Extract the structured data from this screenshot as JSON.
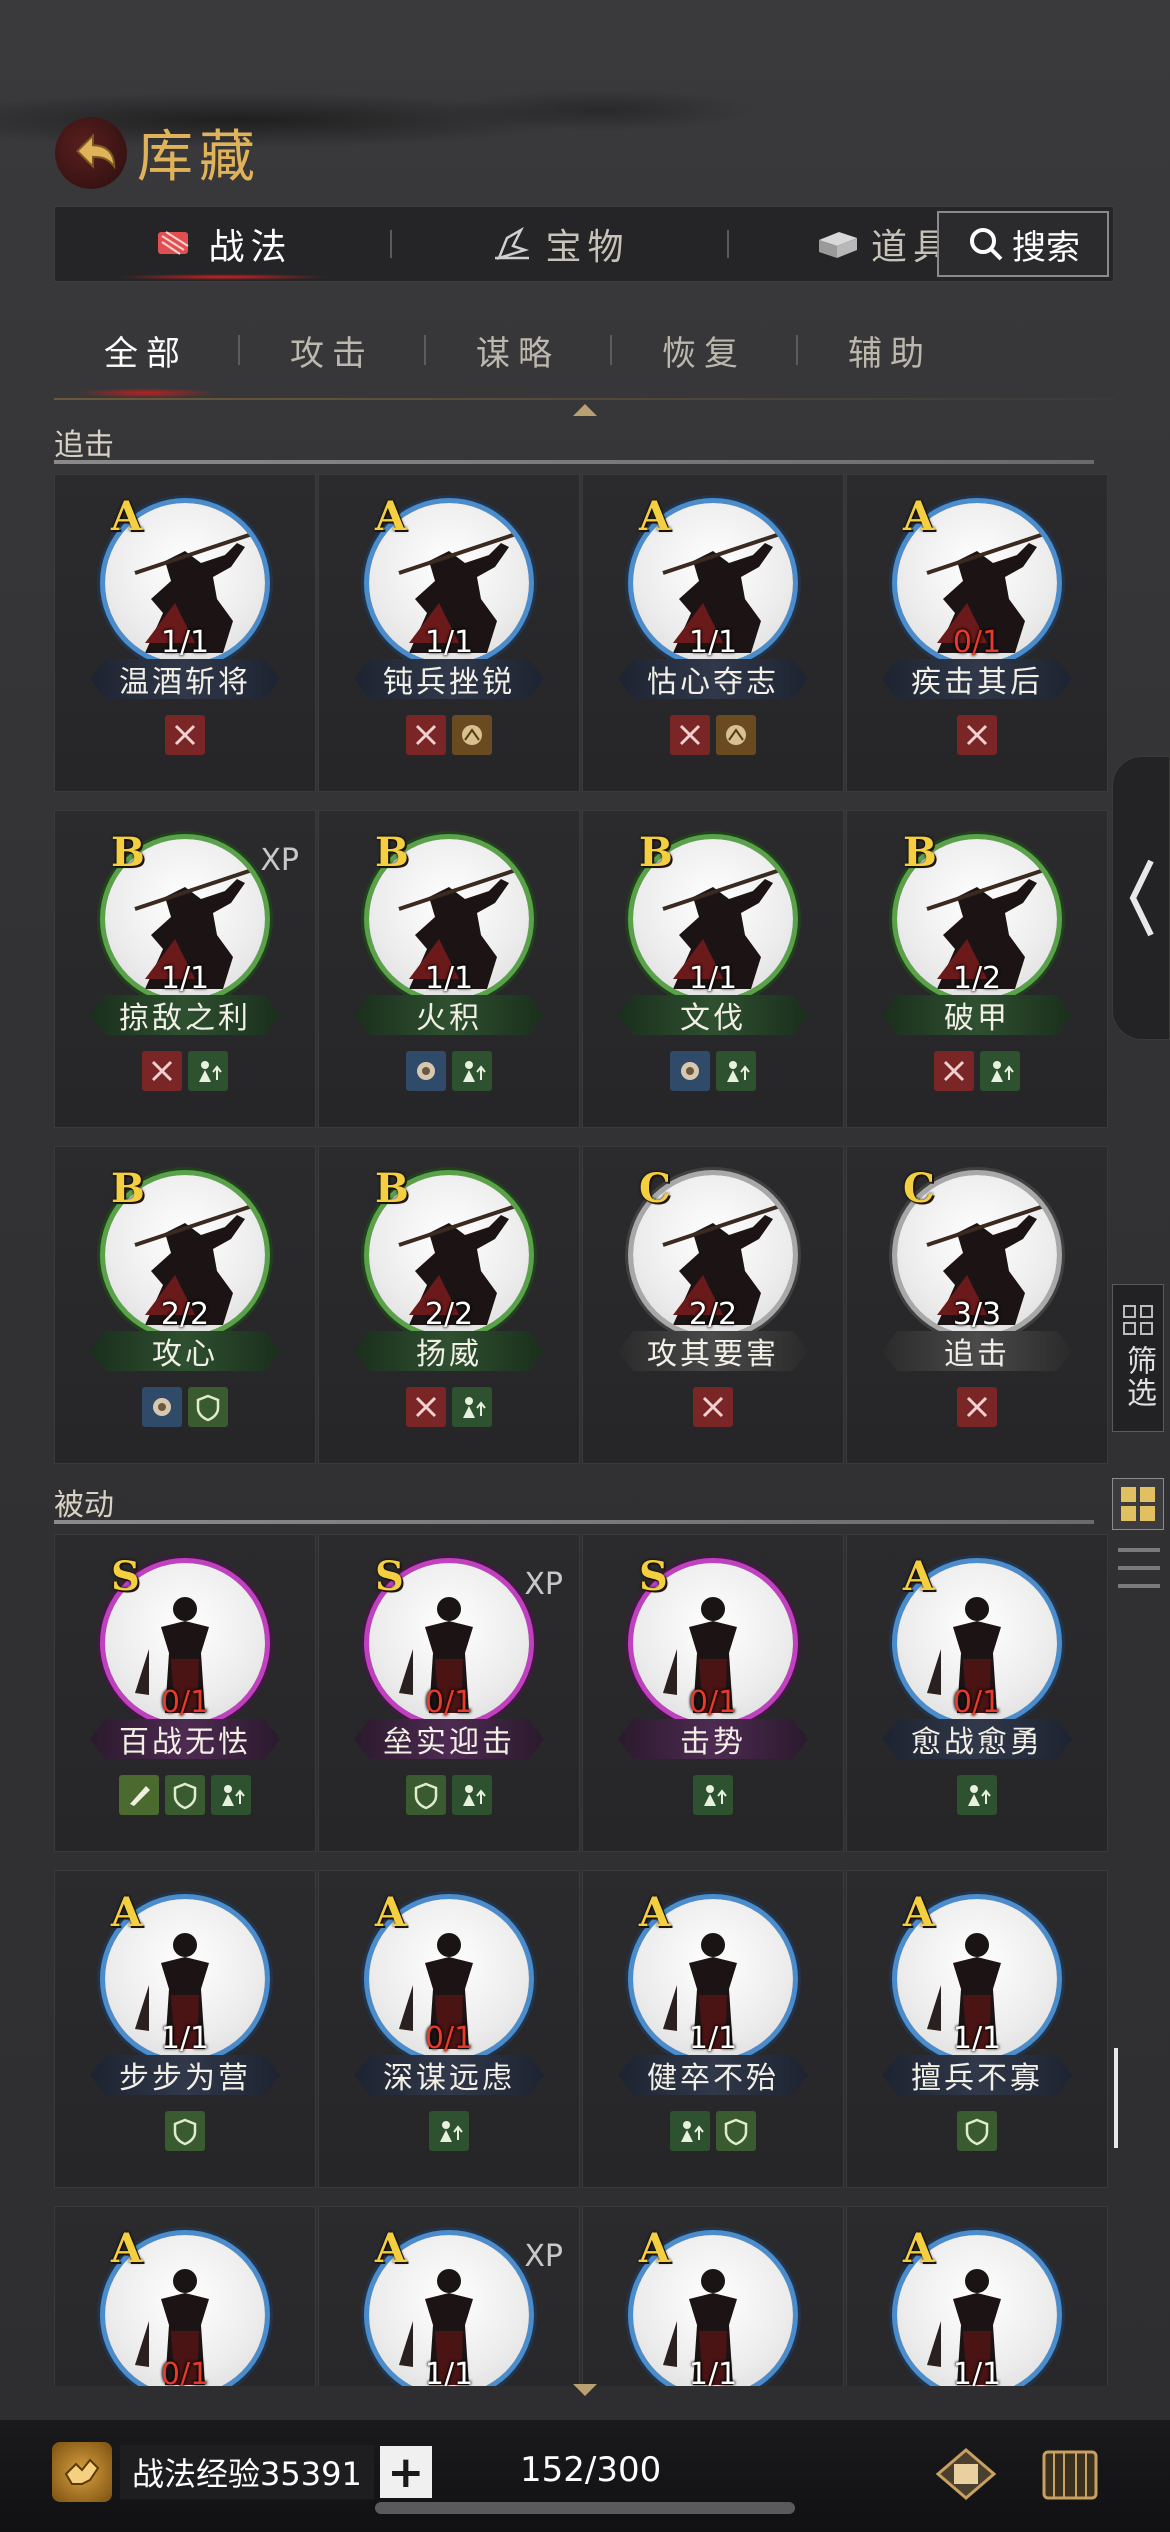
{
  "header": {
    "title": "库藏"
  },
  "main_tabs": [
    {
      "label": "战法",
      "icon": "skill-scroll-icon",
      "active": true
    },
    {
      "label": "宝物",
      "icon": "treasure-icon",
      "active": false
    },
    {
      "label": "道具",
      "icon": "item-box-icon",
      "active": false
    }
  ],
  "search": {
    "label": "搜索"
  },
  "sub_tabs": [
    {
      "label": "全部",
      "active": true
    },
    {
      "label": "攻击",
      "active": false
    },
    {
      "label": "谋略",
      "active": false
    },
    {
      "label": "恢复",
      "active": false
    },
    {
      "label": "辅助",
      "active": false
    }
  ],
  "sections": [
    {
      "title": "追击",
      "cards": [
        {
          "grade": "A",
          "count": "1/1",
          "name": "温酒斩将",
          "xp": "",
          "count_red": false,
          "tags": [
            "attack"
          ]
        },
        {
          "grade": "A",
          "count": "1/1",
          "name": "钝兵挫锐",
          "xp": "",
          "count_red": false,
          "tags": [
            "attack",
            "horse"
          ]
        },
        {
          "grade": "A",
          "count": "1/1",
          "name": "怙心夺志",
          "xp": "",
          "count_red": false,
          "tags": [
            "attack",
            "horse"
          ]
        },
        {
          "grade": "A",
          "count": "0/1",
          "name": "疾击其后",
          "xp": "",
          "count_red": true,
          "tags": [
            "attack"
          ]
        },
        {
          "grade": "B",
          "count": "1/1",
          "name": "掠敌之利",
          "xp": "XP",
          "count_red": false,
          "tags": [
            "attack",
            "stat"
          ]
        },
        {
          "grade": "B",
          "count": "1/1",
          "name": "火积",
          "xp": "",
          "count_red": false,
          "tags": [
            "intel",
            "stat"
          ]
        },
        {
          "grade": "B",
          "count": "1/1",
          "name": "文伐",
          "xp": "",
          "count_red": false,
          "tags": [
            "intel",
            "stat"
          ]
        },
        {
          "grade": "B",
          "count": "1/2",
          "name": "破甲",
          "xp": "",
          "count_red": false,
          "tags": [
            "attack",
            "stat"
          ]
        },
        {
          "grade": "B",
          "count": "2/2",
          "name": "攻心",
          "xp": "",
          "count_red": false,
          "tags": [
            "intel",
            "shield"
          ]
        },
        {
          "grade": "B",
          "count": "2/2",
          "name": "扬威",
          "xp": "",
          "count_red": false,
          "tags": [
            "attack",
            "stat"
          ]
        },
        {
          "grade": "C",
          "count": "2/2",
          "name": "攻其要害",
          "xp": "",
          "count_red": false,
          "tags": [
            "attack"
          ]
        },
        {
          "grade": "C",
          "count": "3/3",
          "name": "追击",
          "xp": "",
          "count_red": false,
          "tags": [
            "attack"
          ]
        }
      ]
    },
    {
      "title": "被动",
      "cards": [
        {
          "grade": "S",
          "count": "0/1",
          "name": "百战无怯",
          "xp": "",
          "count_red": true,
          "tags": [
            "blade",
            "shield",
            "stat"
          ]
        },
        {
          "grade": "S",
          "count": "0/1",
          "name": "垒实迎击",
          "xp": "XP",
          "count_red": true,
          "tags": [
            "shield",
            "stat"
          ]
        },
        {
          "grade": "S",
          "count": "0/1",
          "name": "击势",
          "xp": "",
          "count_red": true,
          "tags": [
            "stat"
          ]
        },
        {
          "grade": "A",
          "count": "0/1",
          "name": "愈战愈勇",
          "xp": "",
          "count_red": true,
          "tags": [
            "stat"
          ]
        },
        {
          "grade": "A",
          "count": "1/1",
          "name": "步步为营",
          "xp": "",
          "count_red": false,
          "tags": [
            "shield"
          ]
        },
        {
          "grade": "A",
          "count": "0/1",
          "name": "深谋远虑",
          "xp": "",
          "count_red": true,
          "tags": [
            "stat"
          ]
        },
        {
          "grade": "A",
          "count": "1/1",
          "name": "健卒不殆",
          "xp": "",
          "count_red": false,
          "tags": [
            "stat",
            "shield"
          ]
        },
        {
          "grade": "A",
          "count": "1/1",
          "name": "擅兵不寡",
          "xp": "",
          "count_red": false,
          "tags": [
            "shield"
          ]
        },
        {
          "grade": "A",
          "count": "0/1",
          "name": "",
          "xp": "",
          "count_red": true,
          "tags": []
        },
        {
          "grade": "A",
          "count": "1/1",
          "name": "",
          "xp": "XP",
          "count_red": false,
          "tags": []
        },
        {
          "grade": "A",
          "count": "1/1",
          "name": "",
          "xp": "",
          "count_red": false,
          "tags": []
        },
        {
          "grade": "A",
          "count": "1/1",
          "name": "",
          "xp": "",
          "count_red": false,
          "tags": []
        }
      ]
    }
  ],
  "side": {
    "filter_label": "筛选"
  },
  "bottom": {
    "exp_label": "战法经验35391",
    "plus": "+",
    "capacity": "152/300"
  },
  "colors": {
    "accent": "#e0b35a",
    "grade_A": "#4a8ccc",
    "grade_B": "#5aa24a",
    "grade_C": "#a8a8a8",
    "grade_S": "#c040c0",
    "count_red": "#e83a2a"
  }
}
